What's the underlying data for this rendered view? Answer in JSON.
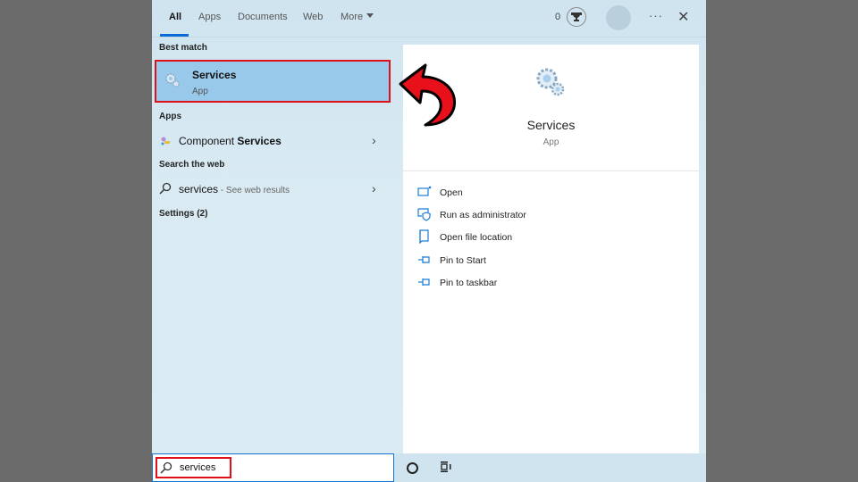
{
  "tabs": [
    {
      "label": "All",
      "active": true
    },
    {
      "label": "Apps",
      "active": false
    },
    {
      "label": "Documents",
      "active": false
    },
    {
      "label": "Web",
      "active": false
    },
    {
      "label": "More",
      "active": false
    }
  ],
  "header": {
    "points": "0",
    "trophy_icon": "trophy-icon",
    "more_options": "···",
    "close": "✕"
  },
  "results": {
    "best_match_heading": "Best match",
    "best_match": {
      "title": "Services",
      "subtitle": "App",
      "icon": "gears-icon"
    },
    "apps_heading": "Apps",
    "apps": [
      {
        "prefix": "Component ",
        "bold": "Services",
        "icon": "component-services-icon"
      }
    ],
    "web_heading": "Search the web",
    "web": {
      "query": "services",
      "suffix": " - See web results"
    },
    "settings_heading": "Settings (2)"
  },
  "preview": {
    "title": "Services",
    "subtitle": "App",
    "actions": [
      {
        "label": "Open",
        "icon": "open-icon"
      },
      {
        "label": "Run as administrator",
        "icon": "run-as-admin-icon"
      },
      {
        "label": "Open file location",
        "icon": "file-location-icon"
      },
      {
        "label": "Pin to Start",
        "icon": "pin-icon"
      },
      {
        "label": "Pin to taskbar",
        "icon": "pin-icon"
      }
    ]
  },
  "search": {
    "value": "services"
  },
  "colors": {
    "accent": "#0a6cd6",
    "highlight": "#e0101a",
    "selected": "#99c9ea"
  }
}
